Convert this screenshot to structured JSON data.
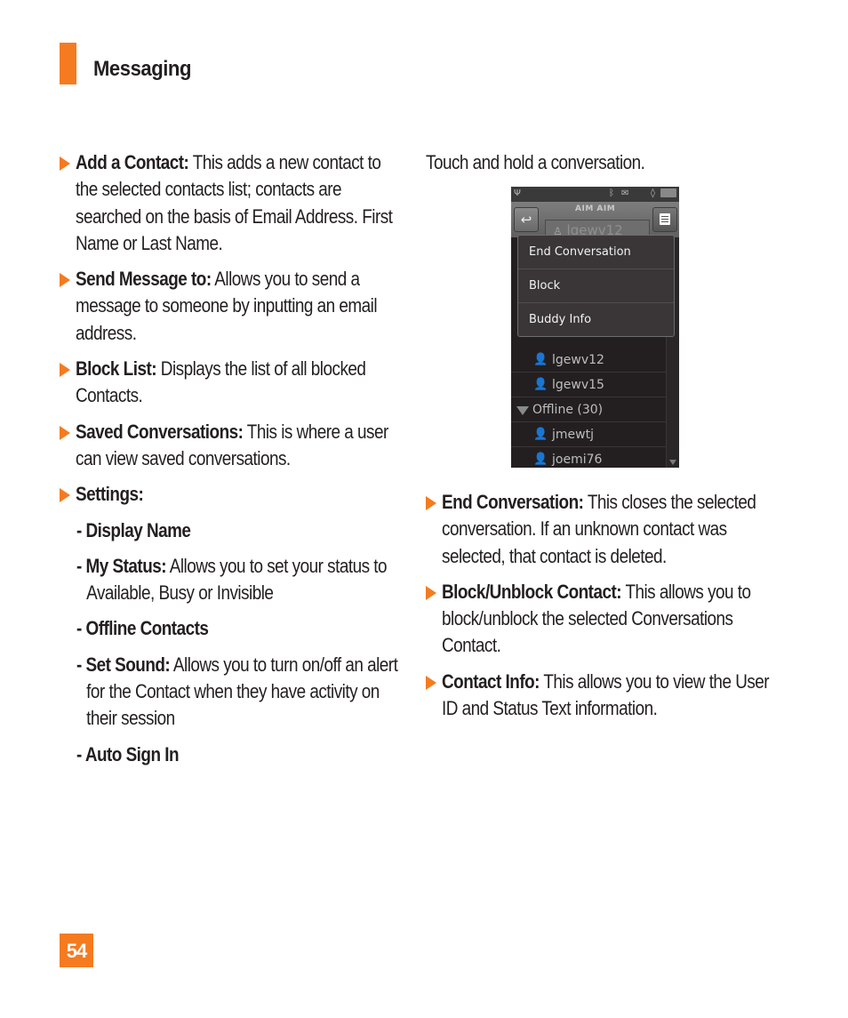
{
  "header": {
    "section_title": "Messaging"
  },
  "left_column": {
    "items": [
      {
        "term": "Add a Contact:",
        "desc": " This adds a new contact to the selected contacts list; contacts are searched on the basis of Email Address. First Name or Last Name."
      },
      {
        "term": "Send Message to:",
        "desc": " Allows you to send a message to someone by inputting an email address."
      },
      {
        "term": "Block List:",
        "desc": " Displays the list of all blocked Contacts."
      },
      {
        "term": "Saved Conversations:",
        "desc": " This is where a user can view saved conversations."
      },
      {
        "term": "Settings:",
        "desc": ""
      }
    ],
    "settings_sub": [
      {
        "term": "- Display Name",
        "desc": ""
      },
      {
        "term": "- My Status:",
        "desc": " Allows you to set your status to Available, Busy or Invisible"
      },
      {
        "term": "- Offline Contacts",
        "desc": ""
      },
      {
        "term": "- Set Sound:",
        "desc": " Allows you to turn on/off an alert for the Contact when they have activity on their session"
      },
      {
        "term": "- Auto Sign In",
        "desc": ""
      }
    ]
  },
  "right_column": {
    "intro": "Touch and hold a conversation.",
    "items": [
      {
        "term": "End Conversation:",
        "desc": " This closes the selected conversation. If an unknown contact was selected, that contact is deleted."
      },
      {
        "term": "Block/Unblock Contact:",
        "desc": " This allows you to block/unblock the selected Conversations Contact."
      },
      {
        "term": "Contact Info:",
        "desc": " This allows you to view the User ID and Status Text information."
      }
    ]
  },
  "phone_screen": {
    "status_icons": [
      "signal-icon",
      "bluetooth-icon",
      "sms-icon",
      "vibrate-icon",
      "battery-icon"
    ],
    "service_label": "AIM AIM",
    "conversation_tab": "lgewv12",
    "context_menu": [
      "End Conversation",
      "Block",
      "Buddy Info"
    ],
    "list": [
      {
        "type": "contact",
        "status": "online",
        "name": "lgewv12"
      },
      {
        "type": "contact",
        "status": "online",
        "name": "lgewv15"
      },
      {
        "type": "group",
        "name": "Offline (30)"
      },
      {
        "type": "contact",
        "status": "offline",
        "name": "jmewtj"
      },
      {
        "type": "contact",
        "status": "offline",
        "name": "joemi76"
      }
    ]
  },
  "footer": {
    "page_number": "54"
  },
  "colors": {
    "accent": "#f47b20",
    "text": "#231f20"
  }
}
